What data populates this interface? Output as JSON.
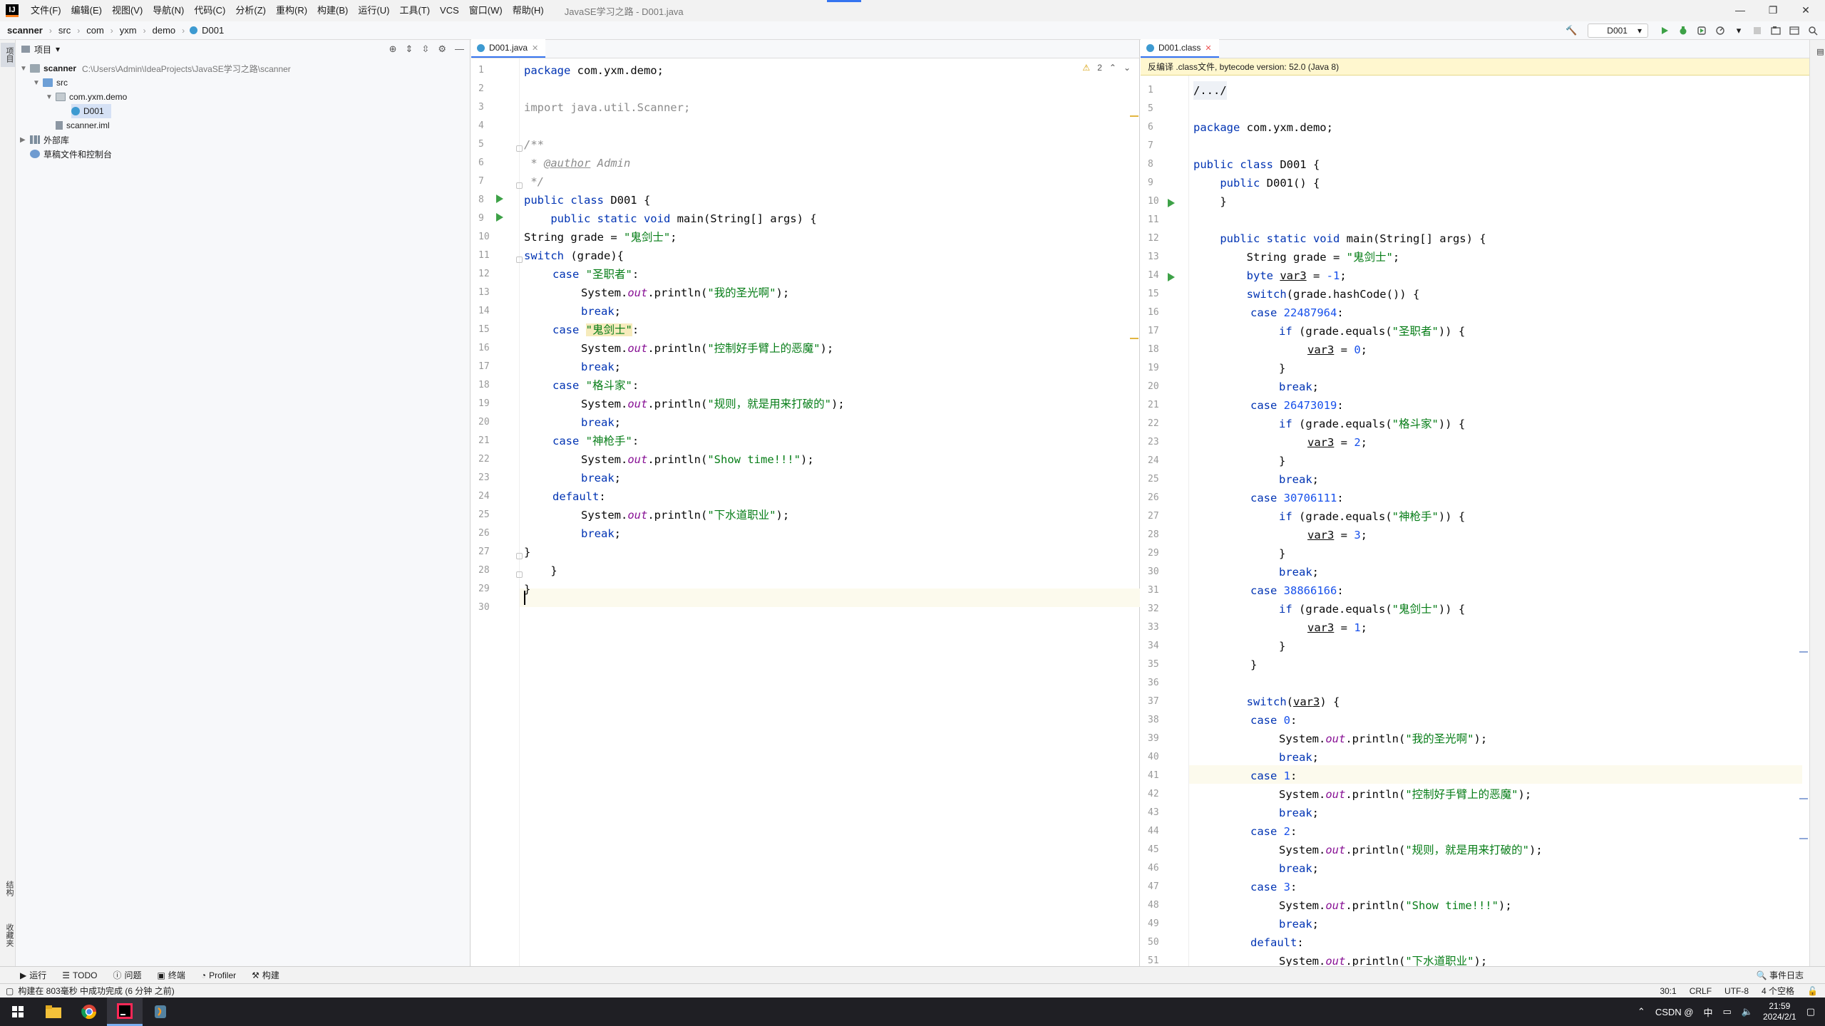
{
  "menubar": {
    "items": [
      "文件(F)",
      "编辑(E)",
      "视图(V)",
      "导航(N)",
      "代码(C)",
      "分析(Z)",
      "重构(R)",
      "构建(B)",
      "运行(U)",
      "工具(T)",
      "VCS",
      "窗口(W)",
      "帮助(H)"
    ],
    "window_title": "JavaSE学习之路 - D001.java"
  },
  "breadcrumb": [
    "scanner",
    "src",
    "com",
    "yxm",
    "demo",
    "D001"
  ],
  "run_config": "D001",
  "project_panel": {
    "title": "项目",
    "tree": {
      "root": "scanner",
      "root_path": "C:\\Users\\Admin\\IdeaProjects\\JavaSE学习之路\\scanner",
      "src": "src",
      "package": "com.yxm.demo",
      "class": "D001",
      "iml": "scanner.iml",
      "external_libs": "外部库",
      "scratches": "草稿文件和控制台"
    }
  },
  "left_stripe": {
    "project": "项目",
    "structure": "结构",
    "favorites": "收藏夹"
  },
  "editor_left": {
    "tab": "D001.java",
    "warnings": "2",
    "line_numbers": [
      "1",
      "2",
      "3",
      "4",
      "5",
      "6",
      "7",
      "8",
      "9",
      "10",
      "11",
      "12",
      "13",
      "14",
      "15",
      "16",
      "17",
      "18",
      "19",
      "20",
      "21",
      "22",
      "23",
      "24",
      "25",
      "26",
      "27",
      "28",
      "29",
      "30"
    ],
    "code": {
      "l1_kw": "package",
      "l1_rest": " com.yxm.demo;",
      "l3": "import java.util.Scanner;",
      "l5": "/**",
      "l6_star": " * ",
      "l6_tag": "@author",
      "l6_rest": " Admin",
      "l7": " */",
      "l8_kw": "public class",
      "l8_rest": " D001 {",
      "l9_kw": "    public static void",
      "l9_rest": " main(String[] args) {",
      "l10_a": "String grade = ",
      "l10_s": "\"鬼剑士\"",
      "l10_b": ";",
      "l11_kw": "switch",
      "l11_rest": " (grade){",
      "case_kw": "case",
      "c1": "\"圣职者\"",
      "p1": "\"我的圣光啊\"",
      "c2": "\"鬼剑士\"",
      "p2": "\"控制好手臂上的恶魔\"",
      "c3": "\"格斗家\"",
      "p3": "\"规则，就是用来打破的\"",
      "c4": "\"神枪手\"",
      "p4": "\"Show time!!!\"",
      "p5": "\"下水道职业\"",
      "sys_a": "System.",
      "sys_out": "out",
      "sys_b": ".println(",
      "sys_c": ");",
      "brk": "break",
      "semi": ";",
      "colon": ":",
      "dflt": "default",
      "close1": "}",
      "close2": "    }",
      "close3": "}"
    }
  },
  "editor_right": {
    "tab": "D001.class",
    "banner": "反编译 .class文件, bytecode version: 52.0 (Java 8)",
    "line_numbers": [
      "1",
      "5",
      "6",
      "7",
      "8",
      "9",
      "10",
      "11",
      "12",
      "13",
      "14",
      "15",
      "16",
      "17",
      "18",
      "19",
      "20",
      "21",
      "22",
      "23",
      "24",
      "25",
      "26",
      "27",
      "28",
      "29",
      "30",
      "31",
      "32",
      "33",
      "34",
      "35",
      "36",
      "37",
      "38",
      "39",
      "40",
      "41",
      "42",
      "43",
      "44",
      "45",
      "46",
      "47",
      "48",
      "49",
      "50",
      "51"
    ],
    "code": {
      "r1": "/.../",
      "r5_kw": "package",
      "r5_rest": " com.yxm.demo;",
      "r8_kw": "public class",
      "r8_rest": " D001 {",
      "r9_kw": "    public",
      "r9_rest": " D001() {",
      "r10": "    }",
      "r12_kw": "    public static void",
      "r12_rest": " main(String[] args) {",
      "r13_a": "        String grade = ",
      "r13_s": "\"鬼剑士\"",
      "r13_b": ";",
      "r14_kw": "        byte",
      "r14_var": "var3",
      "r14_b": " = ",
      "r14_num": "-1",
      "r14_c": ";",
      "r15_kw": "        switch",
      "r15_rest": "(grade.hashCode()) {",
      "h1": "22487964",
      "h2": "26473019",
      "h3": "30706111",
      "h4": "38866166",
      "if_kw": "if",
      "if_a": " (grade.equals(",
      "if_b": ")) {",
      "e1": "\"圣职者\"",
      "e2": "\"格斗家\"",
      "e3": "\"神枪手\"",
      "e4": "\"鬼剑士\"",
      "v0": "0",
      "v2": "2",
      "v3": "3",
      "v1": "1",
      "s2_kw": "        switch",
      "s2_rest": "(",
      "s2_var": "var3",
      "s2_end": ") {",
      "case0": "0",
      "case1": "1",
      "case2": "2",
      "case3": "3"
    }
  },
  "bottom_tools": [
    "运行",
    "TODO",
    "问题",
    "终端",
    "Profiler",
    "构建"
  ],
  "event_log": "事件日志",
  "status": {
    "message": "构建在 803毫秒 中成功完成 (6 分钟 之前)",
    "position": "30:1",
    "line_sep": "CRLF",
    "encoding": "UTF-8",
    "indent": "4 个空格"
  },
  "taskbar": {
    "tray_text": "CSDN @",
    "ime": "中",
    "time": "21:59",
    "date": "2024/2/1"
  },
  "colors": {
    "keyword": "#0033b3",
    "string": "#067d17",
    "comment": "#8c8c8c",
    "number": "#1750eb",
    "field": "#871094",
    "accent": "#3574f0",
    "run": "#3da147"
  }
}
